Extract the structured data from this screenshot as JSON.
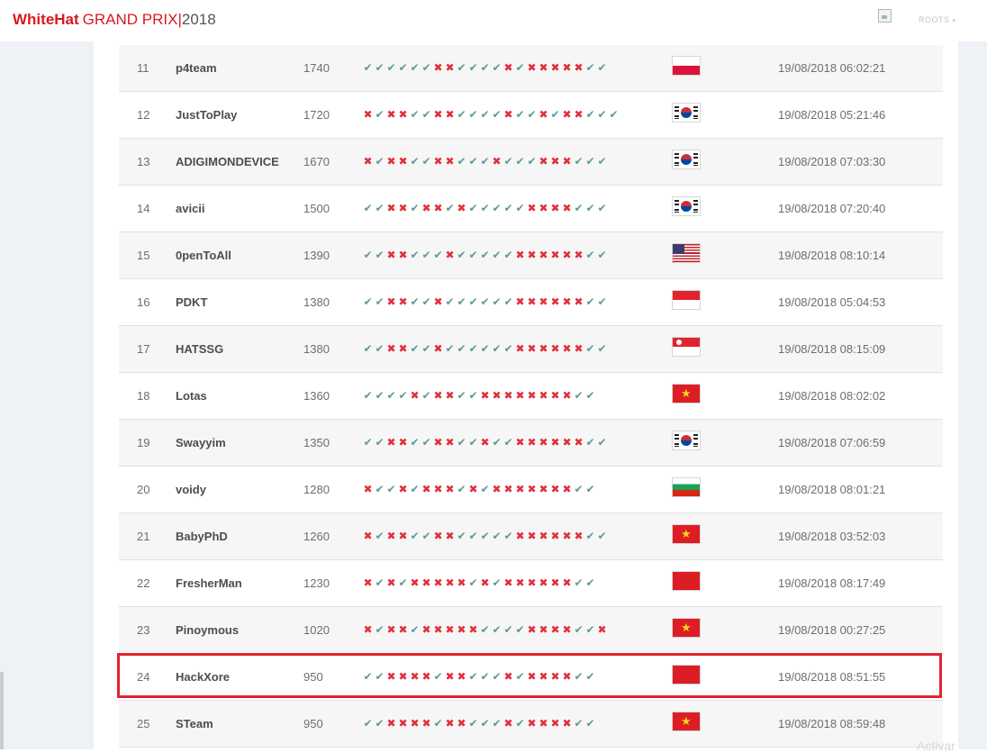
{
  "header": {
    "logo_whitehat": "WhiteHat",
    "logo_grandprix": "GRAND PRIX",
    "logo_separator": "|",
    "logo_year": "2018",
    "user_menu_label": "ROOTS",
    "user_menu_caret": "▾",
    "avatar_icon": "broken-image-icon"
  },
  "scoreboard": {
    "rows": [
      {
        "rank": "11",
        "team": "p4team",
        "score": "1740",
        "marks": "✔✔✔✔✔✔✖✖✔✔✔✔✖✔✖✖✖✖✖✔✔",
        "flag": "pl",
        "time": "19/08/2018 06:02:21"
      },
      {
        "rank": "12",
        "team": "JustToPlay",
        "score": "1720",
        "marks": "✖✔✖✖✔✔✖✖✔✔✔✔✖✔✔✖✔✖✖✔✔✔",
        "flag": "kr",
        "time": "19/08/2018 05:21:46"
      },
      {
        "rank": "13",
        "team": "ADIGIMONDEVICE",
        "score": "1670",
        "marks": "✖✔✖✖✔✔✖✖✔✔✔✖✔✔✔✖✖✖✔✔✔",
        "flag": "kr",
        "time": "19/08/2018 07:03:30"
      },
      {
        "rank": "14",
        "team": "avicii",
        "score": "1500",
        "marks": "✔✔✖✖✔✖✖✔✖✔✔✔✔✔✖✖✖✖✔✔✔",
        "flag": "kr",
        "time": "19/08/2018 07:20:40"
      },
      {
        "rank": "15",
        "team": "0penToAll",
        "score": "1390",
        "marks": "✔✔✖✖✔✔✔✖✔✔✔✔✔✖✖✖✖✖✖✔✔",
        "flag": "us",
        "time": "19/08/2018 08:10:14"
      },
      {
        "rank": "16",
        "team": "PDKT",
        "score": "1380",
        "marks": "✔✔✖✖✔✔✖✔✔✔✔✔✔✖✖✖✖✖✖✔✔",
        "flag": "id",
        "time": "19/08/2018 05:04:53"
      },
      {
        "rank": "17",
        "team": "HATSSG",
        "score": "1380",
        "marks": "✔✔✖✖✔✔✖✔✔✔✔✔✔✖✖✖✖✖✖✔✔",
        "flag": "sg",
        "time": "19/08/2018 08:15:09"
      },
      {
        "rank": "18",
        "team": "Lotas",
        "score": "1360",
        "marks": "✔✔✔✔✖✔✖✖✔✔✖✖✖✖✖✖✖✖✔✔",
        "flag": "vn",
        "time": "19/08/2018 08:02:02"
      },
      {
        "rank": "19",
        "team": "Swayyim",
        "score": "1350",
        "marks": "✔✔✖✖✔✔✖✖✔✔✖✔✔✖✖✖✖✖✖✔✔",
        "flag": "kr",
        "time": "19/08/2018 07:06:59"
      },
      {
        "rank": "20",
        "team": "voidy",
        "score": "1280",
        "marks": "✖✔✔✖✔✖✖✖✔✖✔✖✖✖✖✖✖✖✔✔",
        "flag": "bg",
        "time": "19/08/2018 08:01:21"
      },
      {
        "rank": "21",
        "team": "BabyPhD",
        "score": "1260",
        "marks": "✖✔✖✖✔✔✖✖✔✔✔✔✔✖✖✖✖✖✖✔✔",
        "flag": "vn",
        "time": "19/08/2018 03:52:03"
      },
      {
        "rank": "22",
        "team": "FresherMan",
        "score": "1230",
        "marks": "✖✔✖✔✖✖✖✖✖✔✖✔✖✖✖✖✖✖✔✔",
        "flag": "cn",
        "time": "19/08/2018 08:17:49"
      },
      {
        "rank": "23",
        "team": "Pinoymous",
        "score": "1020",
        "marks": "✖✔✖✖✔✖✖✖✖✖✔✔✔✔✖✖✖✖✔✔✖",
        "flag": "vn",
        "time": "19/08/2018 00:27:25"
      },
      {
        "rank": "24",
        "team": "HackXore",
        "score": "950",
        "marks": "✔✔✖✖✖✖✔✖✖✔✔✔✖✔✖✖✖✖✔✔",
        "flag": "cn",
        "time": "19/08/2018 08:51:55"
      },
      {
        "rank": "25",
        "team": "STeam",
        "score": "950",
        "marks": "✔✔✖✖✖✖✔✖✖✔✔✔✖✔✖✖✖✖✔✔",
        "flag": "vn",
        "time": "19/08/2018 08:59:48"
      }
    ]
  },
  "colors": {
    "brand_red": "#d71920",
    "check_green": "#5f9a8f",
    "cross_red": "#e0303a",
    "highlight_red": "#e0242f"
  },
  "watermark": "Activar"
}
